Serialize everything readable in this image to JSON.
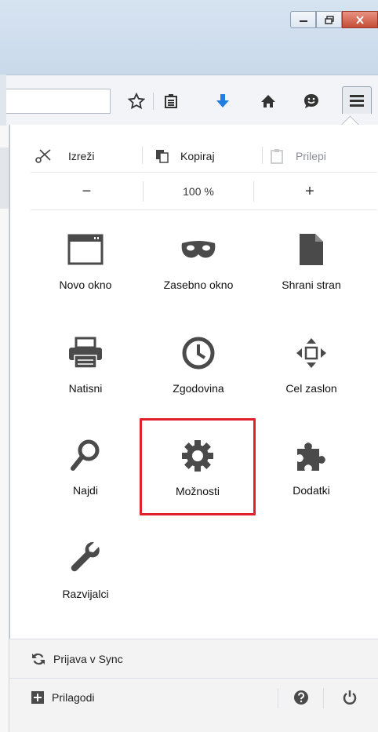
{
  "edit": {
    "cut": "Izreži",
    "copy": "Kopiraj",
    "paste": "Prilepi"
  },
  "zoom": {
    "minus": "−",
    "level": "100 %",
    "plus": "+"
  },
  "items": [
    {
      "label": "Novo okno",
      "icon": "new-window-icon"
    },
    {
      "label": "Zasebno okno",
      "icon": "private-mask-icon"
    },
    {
      "label": "Shrani stran",
      "icon": "save-page-icon"
    },
    {
      "label": "Natisni",
      "icon": "print-icon"
    },
    {
      "label": "Zgodovina",
      "icon": "history-clock-icon"
    },
    {
      "label": "Cel zaslon",
      "icon": "fullscreen-icon"
    },
    {
      "label": "Najdi",
      "icon": "search-icon"
    },
    {
      "label": "Možnosti",
      "icon": "gear-icon",
      "highlighted": true
    },
    {
      "label": "Dodatki",
      "icon": "puzzle-icon"
    },
    {
      "label": "Razvijalci",
      "icon": "wrench-icon"
    }
  ],
  "footer": {
    "sync": "Prijava v Sync",
    "customize": "Prilagodi"
  },
  "colors": {
    "highlight": "#e0202c",
    "download_arrow": "#1f7ee0"
  }
}
